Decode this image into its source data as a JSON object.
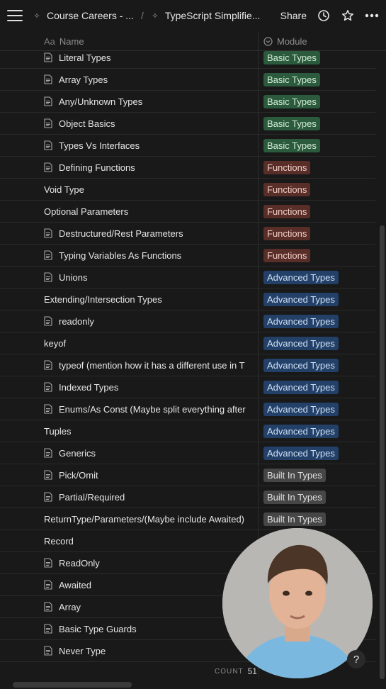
{
  "breadcrumb": {
    "workspace": "Course Careers - ...",
    "separator": "/",
    "page": "TypeScript Simplifie..."
  },
  "header": {
    "share_label": "Share",
    "name_column": "Name",
    "name_column_prefix": "Aa",
    "module_column": "Module"
  },
  "colors": {
    "basic_types": "#2b5a3d",
    "functions": "#5a2e28",
    "advanced_types": "#234068",
    "built_in_types": "#464646",
    "background": "#191919"
  },
  "rows": [
    {
      "name": "Literal Types",
      "has_page_icon": true,
      "module": "Basic Types",
      "module_color": "basic"
    },
    {
      "name": "Array Types",
      "has_page_icon": true,
      "module": "Basic Types",
      "module_color": "basic"
    },
    {
      "name": "Any/Unknown Types",
      "has_page_icon": true,
      "module": "Basic Types",
      "module_color": "basic"
    },
    {
      "name": "Object Basics",
      "has_page_icon": true,
      "module": "Basic Types",
      "module_color": "basic"
    },
    {
      "name": "Types Vs Interfaces",
      "has_page_icon": true,
      "module": "Basic Types",
      "module_color": "basic"
    },
    {
      "name": "Defining Functions",
      "has_page_icon": true,
      "module": "Functions",
      "module_color": "func"
    },
    {
      "name": "Void Type",
      "has_page_icon": false,
      "module": "Functions",
      "module_color": "func"
    },
    {
      "name": "Optional Parameters",
      "has_page_icon": false,
      "module": "Functions",
      "module_color": "func"
    },
    {
      "name": "Destructured/Rest Parameters",
      "has_page_icon": true,
      "module": "Functions",
      "module_color": "func"
    },
    {
      "name": "Typing Variables As Functions",
      "has_page_icon": true,
      "module": "Functions",
      "module_color": "func"
    },
    {
      "name": "Unions",
      "has_page_icon": true,
      "module": "Advanced Types",
      "module_color": "adv"
    },
    {
      "name": "Extending/Intersection Types",
      "has_page_icon": false,
      "module": "Advanced Types",
      "module_color": "adv"
    },
    {
      "name": "readonly",
      "has_page_icon": true,
      "module": "Advanced Types",
      "module_color": "adv"
    },
    {
      "name": "keyof",
      "has_page_icon": false,
      "module": "Advanced Types",
      "module_color": "adv"
    },
    {
      "name": "typeof (mention how it has a different use in T",
      "has_page_icon": true,
      "module": "Advanced Types",
      "module_color": "adv"
    },
    {
      "name": "Indexed Types",
      "has_page_icon": true,
      "module": "Advanced Types",
      "module_color": "adv"
    },
    {
      "name": "Enums/As Const (Maybe split everything after",
      "has_page_icon": true,
      "module": "Advanced Types",
      "module_color": "adv"
    },
    {
      "name": "Tuples",
      "has_page_icon": false,
      "module": "Advanced Types",
      "module_color": "adv"
    },
    {
      "name": "Generics",
      "has_page_icon": true,
      "module": "Advanced Types",
      "module_color": "adv"
    },
    {
      "name": "Pick/Omit",
      "has_page_icon": true,
      "module": "Built In Types",
      "module_color": "built"
    },
    {
      "name": "Partial/Required",
      "has_page_icon": true,
      "module": "Built In Types",
      "module_color": "built"
    },
    {
      "name": "ReturnType/Parameters/(Maybe include Awaited)",
      "has_page_icon": false,
      "module": "Built In Types",
      "module_color": "built"
    },
    {
      "name": "Record",
      "has_page_icon": false,
      "module": "",
      "module_color": ""
    },
    {
      "name": "ReadOnly",
      "has_page_icon": true,
      "module": "",
      "module_color": ""
    },
    {
      "name": "Awaited",
      "has_page_icon": true,
      "module": "",
      "module_color": ""
    },
    {
      "name": "Array",
      "has_page_icon": true,
      "module": "",
      "module_color": ""
    },
    {
      "name": "Basic Type Guards",
      "has_page_icon": true,
      "module": "",
      "module_color": ""
    },
    {
      "name": "Never Type",
      "has_page_icon": true,
      "module": "",
      "module_color": ""
    }
  ],
  "footer": {
    "count_label": "COUNT",
    "count_value": "51",
    "help_label": "?"
  }
}
